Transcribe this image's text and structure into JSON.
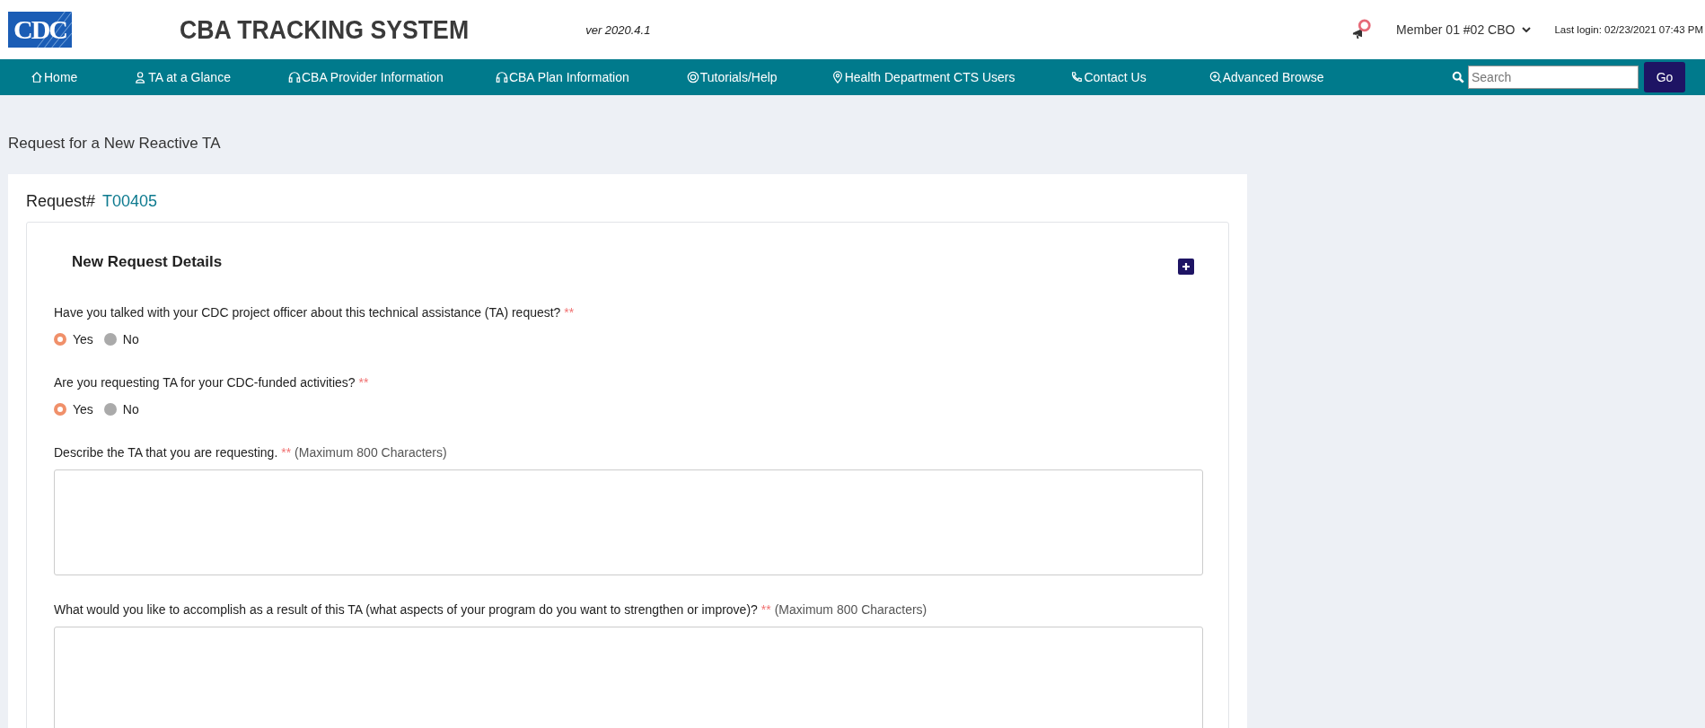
{
  "header": {
    "logo_text": "CDC",
    "title": "CBA TRACKING SYSTEM",
    "version": "ver 2020.4.1",
    "user_menu": "Member 01 #02 CBO",
    "last_login": "Last login: 02/23/2021 07:43 PM"
  },
  "nav": {
    "items": [
      {
        "label": "Home"
      },
      {
        "label": "TA at a Glance"
      },
      {
        "label": " CBA Provider Information"
      },
      {
        "label": " CBA Plan Information"
      },
      {
        "label": "Tutorials/Help"
      },
      {
        "label": "Health Department CTS Users"
      },
      {
        "label": "Contact Us"
      },
      {
        "label": "Advanced Browse"
      }
    ],
    "search": {
      "placeholder": "Search"
    },
    "go_button": "Go"
  },
  "page_title": "Request for a New Reactive TA",
  "request": {
    "label": "Request#",
    "number": "T00405"
  },
  "section": {
    "title": "New Request Details",
    "questions": [
      {
        "kind": "radio",
        "label": "Have you talked with your CDC project officer about this technical assistance (TA) request?",
        "required_mark": "**",
        "options": [
          {
            "label": "Yes",
            "selected": true
          },
          {
            "label": "No",
            "selected": false
          }
        ]
      },
      {
        "kind": "radio",
        "label": "Are you requesting TA for your CDC-funded activities?",
        "required_mark": "**",
        "options": [
          {
            "label": "Yes",
            "selected": true
          },
          {
            "label": "No",
            "selected": false
          }
        ]
      },
      {
        "kind": "textarea",
        "label": "Describe the TA that you are requesting.",
        "required_mark": "**",
        "note": "(Maximum 800 Characters)"
      },
      {
        "kind": "textarea",
        "label": "What would you like to accomplish as a result of this TA (what aspects of your program do you want to strengthen or improve)?",
        "required_mark": "**",
        "note": "(Maximum 800 Characters)"
      }
    ]
  }
}
